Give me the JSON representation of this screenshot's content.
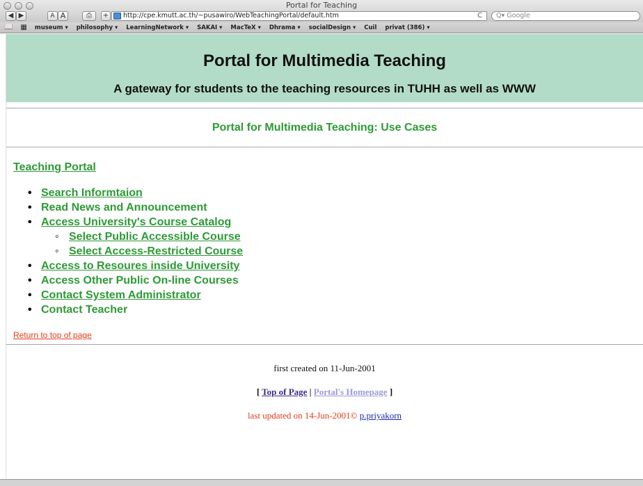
{
  "window": {
    "title": "Portal for Teaching"
  },
  "toolbar": {
    "back_label": "◀",
    "forward_label": "▶",
    "text_smaller_label": "A",
    "text_larger_label": "A",
    "print_label": "⎙",
    "add_bookmark_label": "+",
    "url": "http://cpe.kmutt.ac.th/~pusawiro/WebTeachingPortal/default.htm",
    "reload_label": "C",
    "search_placeholder": "Q▾ Google"
  },
  "bookmarks": {
    "book_icon": "📖",
    "grid_icon": "▦",
    "items": [
      "museum ▾",
      "philosophy ▾",
      "LearningNetwork ▾",
      "SAKAI ▾",
      "MacTeX ▾",
      "Dhrama ▾",
      "socialDesign ▾",
      "Cuil",
      "privat (386) ▾"
    ]
  },
  "header": {
    "title": "Portal for Multimedia Teaching",
    "subtitle": "A gateway for students to the teaching resources in TUHH as well as WWW"
  },
  "usecase": {
    "title": "Portal for Multimedia Teaching: Use Cases"
  },
  "portal": {
    "heading": "Teaching Portal",
    "items": [
      "Search Informtaion",
      "Read News and Announcement",
      "Access University's Course Catalog",
      "Access to Resoures inside University",
      "Access Other Public On-line Courses",
      "Contact System Administrator",
      "Contact Teacher"
    ],
    "subitems": [
      "Select Public Accessible Course",
      "Select Access-Restricted Course"
    ]
  },
  "return_link": "Return to top of page",
  "footer": {
    "created": "first created on 11-Jun-2001",
    "nav_open": "[ ",
    "top_of_page": "Top of Page",
    "separator": " | ",
    "portal_home": "Portal's Homepage",
    "nav_close": " ]",
    "updated": "last updated on 14-Jun-2001© ",
    "author": "p.priyakorn"
  },
  "colors": {
    "header_band": "#b2dcc7",
    "green_text": "#2d9a36",
    "red_text": "#e43a1a"
  }
}
